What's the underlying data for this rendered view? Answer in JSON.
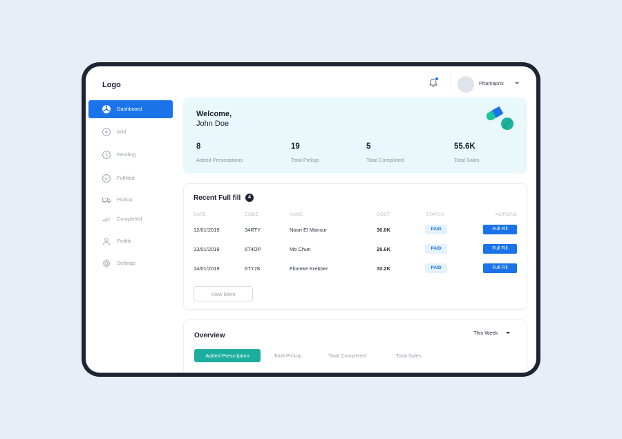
{
  "app": {
    "logo": "Logo"
  },
  "header": {
    "user_name": "Phamaprix"
  },
  "sidebar": {
    "items": [
      {
        "label": "Dashboard",
        "icon": "dashboard-icon",
        "active": true
      },
      {
        "label": "Add",
        "icon": "plus-circle-icon"
      },
      {
        "label": "Pending",
        "icon": "clock-icon"
      },
      {
        "label": "Fulfilled",
        "icon": "check-circle-icon"
      },
      {
        "label": "Pickup",
        "icon": "truck-icon"
      },
      {
        "label": "Completed",
        "icon": "double-check-icon"
      },
      {
        "label": "Profile",
        "icon": "user-icon"
      },
      {
        "label": "Settings",
        "icon": "gear-icon"
      }
    ]
  },
  "welcome": {
    "title": "Welcome,",
    "name": "John Doe",
    "stats": [
      {
        "value": "8",
        "label": "Added Prescriptions"
      },
      {
        "value": "19",
        "label": "Total Pickup"
      },
      {
        "value": "5",
        "label": "Total Completed"
      },
      {
        "value": "55.6K",
        "label": "Total Sales"
      }
    ]
  },
  "recent": {
    "title": "Recent Full fill",
    "count": "4",
    "columns": [
      "DATE",
      "CODE",
      "NAME",
      "COST",
      "STATUS",
      "ACTIONS"
    ],
    "rows": [
      {
        "date": "12/01/2019",
        "code": "34RTY",
        "name": "Noori El Mansur",
        "cost": "30.8K",
        "status": "PAID",
        "action": "Full Fill"
      },
      {
        "date": "13/01/2019",
        "code": "6T4OP",
        "name": "Mo Chun",
        "cost": "29.6K",
        "status": "PAID",
        "action": "Full Fill"
      },
      {
        "date": "14/01/2019",
        "code": "6TY78",
        "name": "Florieke Krebber",
        "cost": "33.2K",
        "status": "PAID",
        "action": "Full Fill"
      }
    ],
    "view_more": "View More"
  },
  "overview": {
    "title": "Overview",
    "period": "This Week",
    "tabs": [
      "Added Prescription",
      "Total Pickup",
      "Total Completed",
      "Total Sales"
    ]
  },
  "colors": {
    "primary": "#1a73e8",
    "teal": "#1bae9f",
    "welcome_bg": "#e9f8fb",
    "frame": "#1f2433"
  }
}
